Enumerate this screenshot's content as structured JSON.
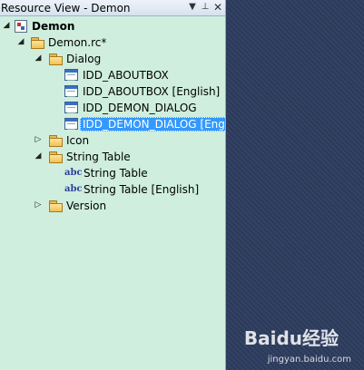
{
  "titlebar": {
    "title": "Resource View - Demon",
    "dropdown_icon": "chevron-down-icon",
    "pin_icon": "pin-icon",
    "close_icon": "close-icon"
  },
  "tree": {
    "root": "Demon",
    "rc_file": "Demon.rc*",
    "dialog_folder": "Dialog",
    "dialogs": [
      "IDD_ABOUTBOX",
      "IDD_ABOUTBOX [English]",
      "IDD_DEMON_DIALOG",
      "IDD_DEMON_DIALOG [English]"
    ],
    "icon_folder": "Icon",
    "string_table_folder": "String Table",
    "string_tables": [
      "String Table",
      "String Table [English]"
    ],
    "version_folder": "Version",
    "expanded_glyph": "◢",
    "collapsed_glyph": "▷",
    "string_icon_text": "abc"
  },
  "watermark": {
    "brand": "Baidu经验",
    "url": "jingyan.baidu.com"
  }
}
